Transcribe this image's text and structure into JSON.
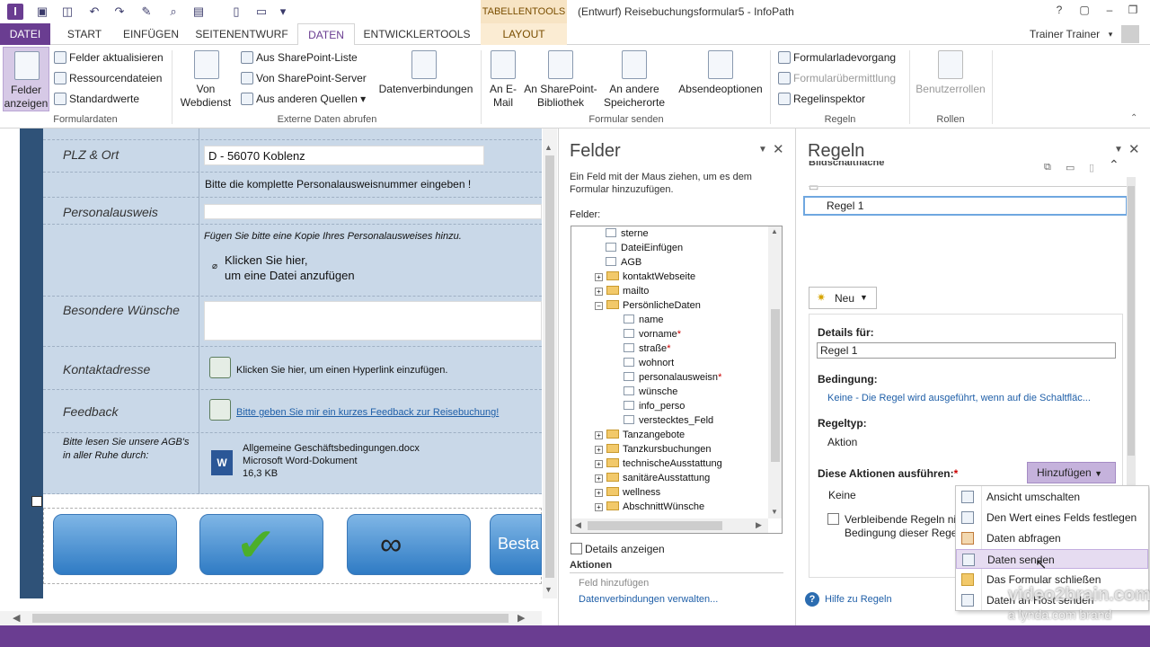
{
  "window": {
    "title": "(Entwurf) Reisebuchungsformular5 - InfoPath",
    "context_group": "TABELLENTOOLS",
    "user": "Trainer Trainer",
    "help": "?"
  },
  "tabs": [
    "DATEI",
    "START",
    "EINFÜGEN",
    "SEITENENTWURF",
    "DATEN",
    "ENTWICKLERTOOLS",
    "LAYOUT"
  ],
  "ribbon": {
    "formulardaten": {
      "big": "Felder\nanzeigen",
      "felder_aktualisieren": "Felder aktualisieren",
      "ressourcendateien": "Ressourcendateien",
      "standardwerte": "Standardwerte",
      "group": "Formulardaten"
    },
    "extern": {
      "webdienst": "Von\nWebdienst",
      "sp_liste": "Aus SharePoint-Liste",
      "sp_server": "Von SharePoint-Server",
      "andere": "Aus anderen Quellen",
      "datenverbindungen": "Datenverbindungen",
      "group": "Externe Daten abrufen"
    },
    "senden": {
      "email": "An E-\nMail",
      "sp_bib": "An SharePoint-\nBibliothek",
      "andere_orte": "An andere\nSpeicherorte",
      "absendeoptionen": "Absendeoptionen",
      "group": "Formular senden"
    },
    "regeln": {
      "ladevorgang": "Formularladevorgang",
      "uebermittlung": "Formularübermittlung",
      "inspektor": "Regelinspektor",
      "group": "Regeln"
    },
    "rollen": {
      "benutzerrollen": "Benutzerrollen",
      "group": "Rollen"
    }
  },
  "form": {
    "plz_label": "PLZ & Ort",
    "plz_value": "D - 56070 Koblenz",
    "ausweis_hint": "Bitte die komplette Personalausweisnummer eingeben !",
    "ausweis_label": "Personalausweis",
    "kopie_hint": "Fügen Sie bitte eine Kopie Ihres Personalausweises hinzu.",
    "attach_line1": "Klicken Sie hier,",
    "attach_line2": "um eine Datei anzufügen",
    "wuensche_label": "Besondere Wünsche",
    "kontakt_label": "Kontaktadresse",
    "kontakt_text": "Klicken Sie hier, um einen Hyperlink einzufügen.",
    "feedback_label": "Feedback",
    "feedback_link": "Bitte geben Sie mir ein kurzes Feedback zur Reisebuchung!",
    "agb_label": "Bitte lesen Sie unsere AGB's in aller Ruhe durch:",
    "doc_name": "Allgemeine Geschäftsbedingungen.docx",
    "doc_type": "Microsoft Word-Dokument",
    "doc_size": "16,3 KB",
    "btn4_text": "Besta"
  },
  "felder": {
    "title": "Felder",
    "hint": "Ein Feld mit der Maus ziehen, um es dem Formular hinzuzufügen.",
    "tree_label": "Felder:",
    "items": [
      {
        "label": "sterne",
        "kind": "file",
        "indent": 1
      },
      {
        "label": "DateiEinfügen",
        "kind": "file",
        "indent": 1
      },
      {
        "label": "AGB",
        "kind": "file",
        "indent": 1
      },
      {
        "label": "kontaktWebseite",
        "kind": "folder",
        "indent": 0,
        "pm": "+"
      },
      {
        "label": "mailto",
        "kind": "folder",
        "indent": 0,
        "pm": "+"
      },
      {
        "label": "PersönlicheDaten",
        "kind": "folder",
        "indent": 0,
        "pm": "−"
      },
      {
        "label": "name",
        "kind": "file",
        "indent": 2
      },
      {
        "label": "vorname",
        "kind": "file",
        "indent": 2,
        "req": true
      },
      {
        "label": "straße",
        "kind": "file",
        "indent": 2,
        "req": true
      },
      {
        "label": "wohnort",
        "kind": "file",
        "indent": 2
      },
      {
        "label": "personalausweisn",
        "kind": "file",
        "indent": 2,
        "req": true
      },
      {
        "label": "wünsche",
        "kind": "file",
        "indent": 2
      },
      {
        "label": "info_perso",
        "kind": "file",
        "indent": 2
      },
      {
        "label": "verstecktes_Feld",
        "kind": "file",
        "indent": 2
      },
      {
        "label": "Tanzangebote",
        "kind": "folder",
        "indent": 0,
        "pm": "+"
      },
      {
        "label": "Tanzkursbuchungen",
        "kind": "folder",
        "indent": 0,
        "pm": "+"
      },
      {
        "label": "technischeAusstattung",
        "kind": "folder",
        "indent": 0,
        "pm": "+"
      },
      {
        "label": "sanitäreAusstattung",
        "kind": "folder",
        "indent": 0,
        "pm": "+"
      },
      {
        "label": "wellness",
        "kind": "folder",
        "indent": 0,
        "pm": "+"
      },
      {
        "label": "AbschnittWünsche",
        "kind": "folder",
        "indent": 0,
        "pm": "+"
      }
    ],
    "details": "Details anzeigen",
    "aktionen": "Aktionen",
    "feld_hinzu": "Feld hinzufügen",
    "datenverb": "Datenverbindungen verwalten..."
  },
  "regeln": {
    "title": "Regeln",
    "control": "Bildschaltfläche",
    "rule_item": "Regel 1",
    "neu": "Neu",
    "details_fuer": "Details für:",
    "details_value": "Regel 1",
    "bedingung": "Bedingung:",
    "bedingung_value": "Keine - Die Regel wird ausgeführt, wenn auf die Schaltfläc...",
    "regeltyp": "Regeltyp:",
    "regeltyp_value": "Aktion",
    "aktionen": "Diese Aktionen ausführen:",
    "req": "*",
    "hinzufuegen": "Hinzufügen",
    "keine": "Keine",
    "verbleibend1": "Verbleibende Regeln ni",
    "verbleibend2": "Bedingung dieser Regel",
    "hilfe": "Hilfe zu Regeln"
  },
  "menu": [
    "Ansicht umschalten",
    "Den Wert eines Felds festlegen",
    "Daten abfragen",
    "Daten senden",
    "Das Formular schließen",
    "Daten an Host senden"
  ],
  "watermark": {
    "line1": "video2brain.com",
    "line2": "a lynda.com brand"
  },
  "colors": {
    "accent": "#6a3d91",
    "form_bg": "#c9d8e8",
    "sidebar": "#2f5278"
  }
}
